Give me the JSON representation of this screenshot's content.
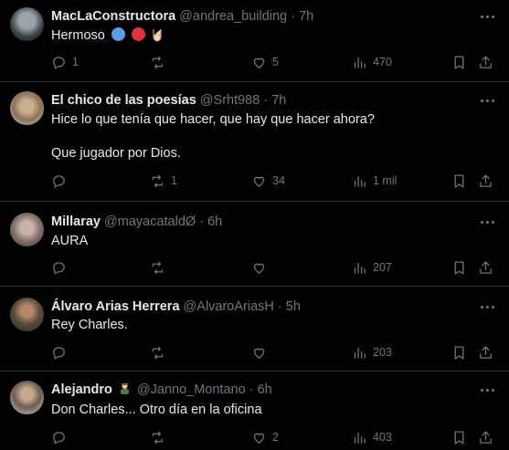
{
  "tweets": [
    {
      "name": "MacLaConstructora",
      "handle": "@andrea_building",
      "time": "7h",
      "lines": [
        "Hermoso"
      ],
      "emojis": [
        "blue-heart-circle",
        "red-heart-circle",
        "rock-hand"
      ],
      "replies": "1",
      "retweets": "",
      "likes": "5",
      "views": "470"
    },
    {
      "name": "El chico de las poesías",
      "handle": "@Srht988",
      "time": "7h",
      "lines": [
        "Hice lo que tenía que hacer, que hay que hacer ahora?",
        "",
        "Que jugador por Dios."
      ],
      "replies": "",
      "retweets": "1",
      "likes": "34",
      "views": "1 mil"
    },
    {
      "name": "Millaray",
      "handle": "@mayacataldØ",
      "time": "6h",
      "lines": [
        "AURA"
      ],
      "replies": "",
      "retweets": "",
      "likes": "",
      "views": "207"
    },
    {
      "name": "Álvaro Arias Herrera",
      "handle": "@AlvaroAriasH",
      "time": "5h",
      "lines": [
        "Rey Charles."
      ],
      "replies": "",
      "retweets": "",
      "likes": "",
      "views": "203"
    },
    {
      "name": "Alejandro",
      "handle": "@Janno_Montano",
      "time": "6h",
      "lines": [
        "Don Charles... Otro día en la oficina"
      ],
      "replies": "",
      "retweets": "",
      "likes": "2",
      "views": "403"
    }
  ],
  "separator": "·",
  "colors": {
    "background": "#000000",
    "text": "#e7e9ea",
    "muted": "#71767b",
    "divider": "#2f3336"
  }
}
